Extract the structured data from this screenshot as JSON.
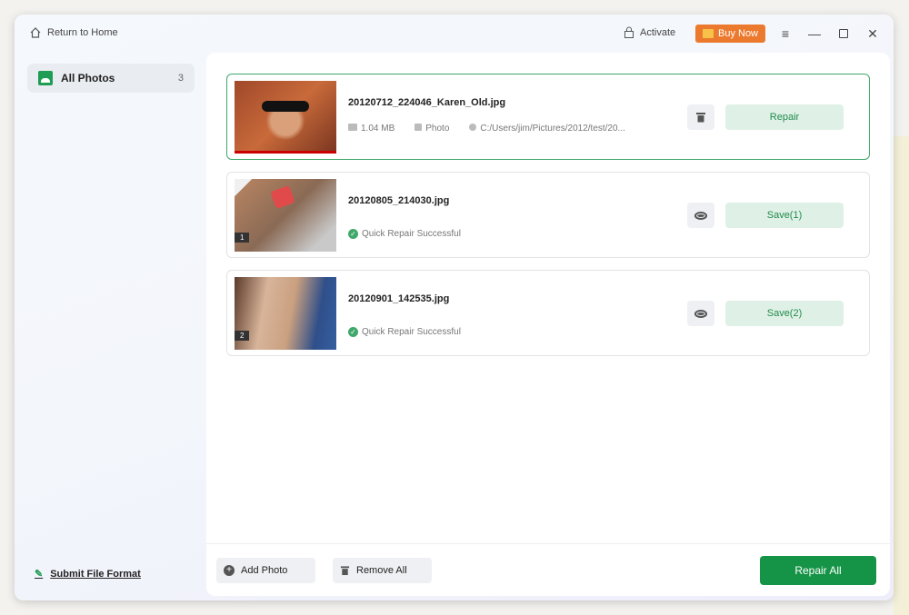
{
  "header": {
    "return_home": "Return to Home",
    "activate": "Activate",
    "buy_now": "Buy Now"
  },
  "sidebar": {
    "items": [
      {
        "label": "All Photos",
        "count": "3"
      }
    ],
    "submit": "Submit File Format"
  },
  "files": [
    {
      "name": "20120712_224046_Karen_Old.jpg",
      "size": "1.04 MB",
      "type": "Photo",
      "path": "C:/Users/jim/Pictures/2012/test/20...",
      "action": "Repair",
      "icon": "trash-icon"
    },
    {
      "name": "20120805_214030.jpg",
      "status": "Quick Repair Successful",
      "badge": "1",
      "action": "Save(1)",
      "icon": "eye-icon"
    },
    {
      "name": "20120901_142535.jpg",
      "status": "Quick Repair Successful",
      "badge": "2",
      "action": "Save(2)",
      "icon": "eye-icon"
    }
  ],
  "footer": {
    "add_photo": "Add Photo",
    "remove_all": "Remove All",
    "repair_all": "Repair All"
  },
  "colors": {
    "accent": "#159447",
    "buy": "#ec7a2e"
  }
}
